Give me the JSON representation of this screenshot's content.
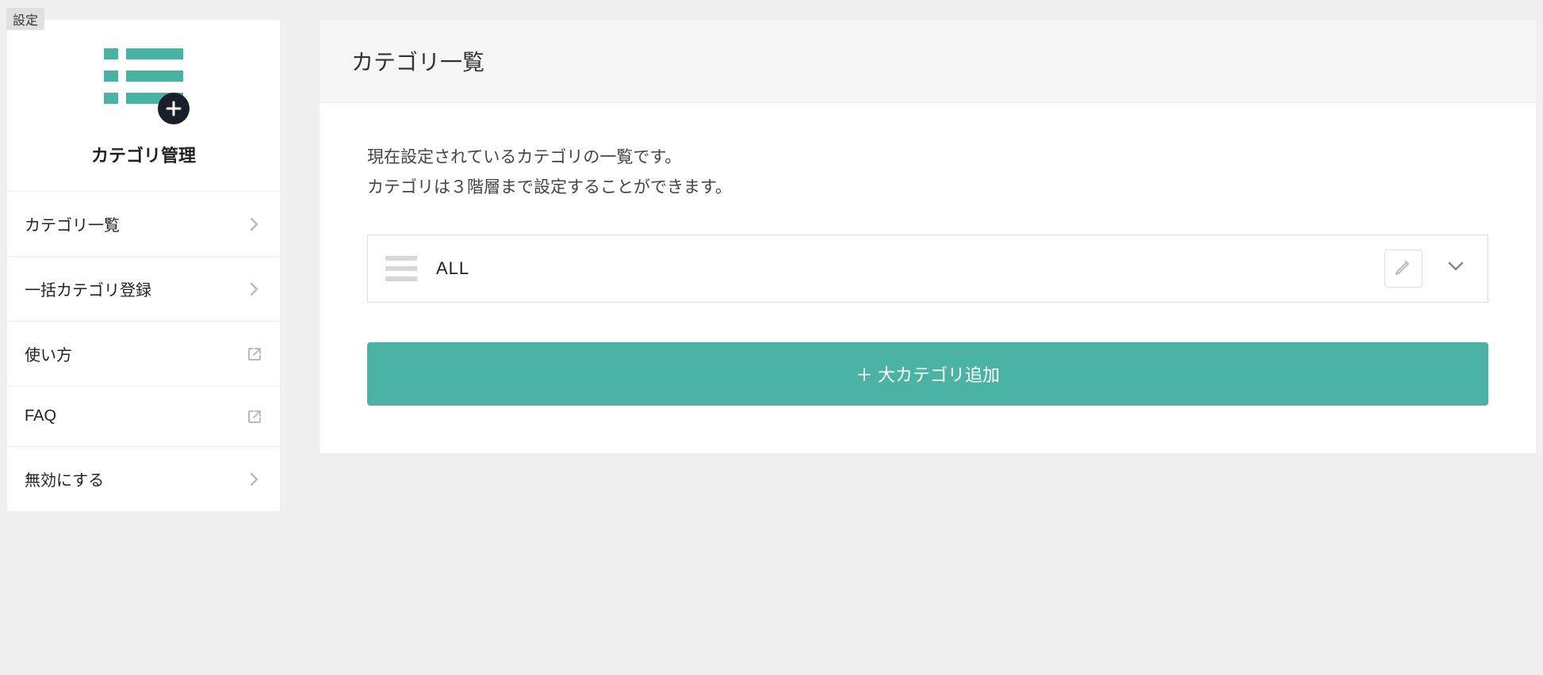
{
  "badge": {
    "label": "設定"
  },
  "sidebar": {
    "title": "カテゴリ管理",
    "items": [
      {
        "label": "カテゴリ一覧",
        "link_type": "chevron"
      },
      {
        "label": "一括カテゴリ登録",
        "link_type": "chevron"
      },
      {
        "label": "使い方",
        "link_type": "external"
      },
      {
        "label": "FAQ",
        "link_type": "external"
      },
      {
        "label": "無効にする",
        "link_type": "chevron"
      }
    ]
  },
  "main": {
    "title": "カテゴリ一覧",
    "description_line1": "現在設定されているカテゴリの一覧です。",
    "description_line2": "カテゴリは３階層まで設定することができます。",
    "category": {
      "name": "ALL"
    },
    "add_button_label": "＋ 大カテゴリ追加"
  }
}
